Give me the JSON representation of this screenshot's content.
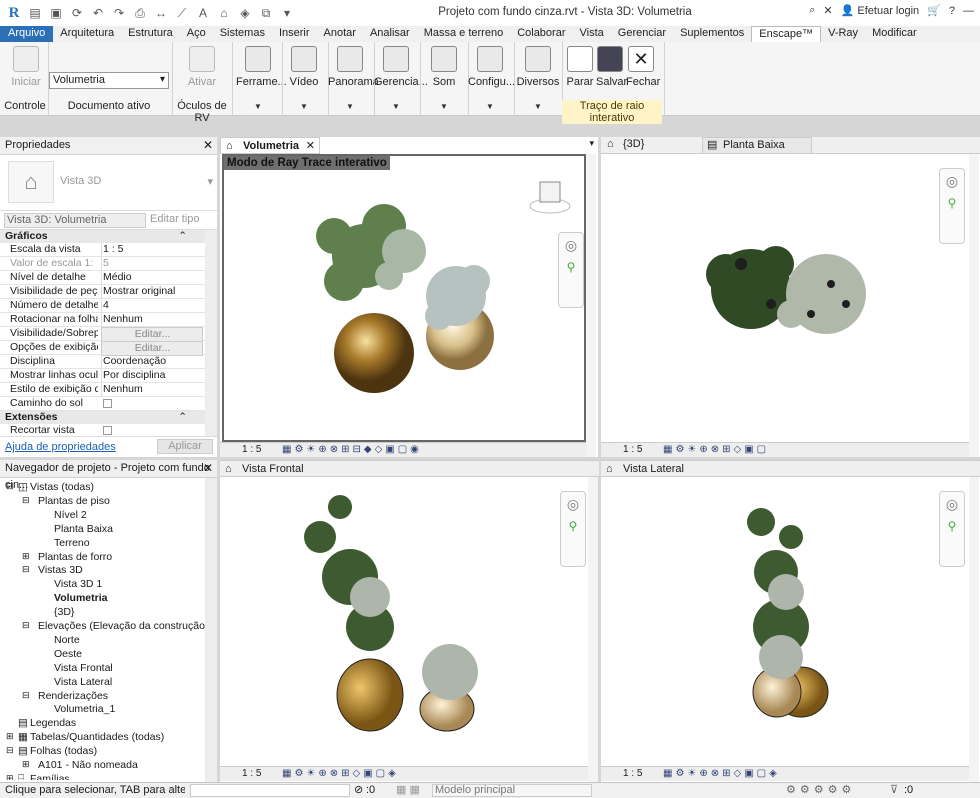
{
  "window_title": "Projeto com fundo cinza.rvt - Vista 3D: Volumetria",
  "user": {
    "login_label": "Efetuar login"
  },
  "tabs": [
    "Arquivo",
    "Arquitetura",
    "Estrutura",
    "Aço",
    "Sistemas",
    "Inserir",
    "Anotar",
    "Analisar",
    "Massa e terreno",
    "Colaborar",
    "Vista",
    "Gerenciar",
    "Suplementos",
    "Enscape™",
    "V-Ray",
    "Modificar"
  ],
  "ribbon": {
    "controle": {
      "start_label": "Iniciar",
      "panel_label": "Controle"
    },
    "documento": {
      "select_value": "Volumetria",
      "panel_label": "Documento ativo"
    },
    "oculos": {
      "activate_label": "Ativar",
      "panel_label": "Óculos de RV"
    },
    "buttons": [
      "Ferrame...",
      "Vídeo",
      "Panorama",
      "Gerencia...",
      "Som",
      "Configu...",
      "Diversos"
    ],
    "raytrace": {
      "buttons": [
        "Parar",
        "Salvar",
        "Fechar"
      ],
      "panel_label": "Traço de raio interativo"
    }
  },
  "properties": {
    "title": "Propriedades",
    "type_name": "Vista 3D",
    "view_selector": "Vista 3D: Volumetria",
    "edit_type": "Editar tipo",
    "groups": [
      {
        "name": "Gráficos",
        "rows": [
          {
            "k": "Escala da vista",
            "v": "1 : 5"
          },
          {
            "k": "Valor de escala   1:",
            "v": "5"
          },
          {
            "k": "Nível de detalhe",
            "v": "Médio"
          },
          {
            "k": "Visibilidade de peças",
            "v": "Mostrar original"
          },
          {
            "k": "Número de detalhe",
            "v": "4"
          },
          {
            "k": "Rotacionar na folha",
            "v": "Nenhum"
          },
          {
            "k": "Visibilidade/Sobrep...",
            "v": "Editar..."
          },
          {
            "k": "Opções de exibição...",
            "v": "Editar..."
          },
          {
            "k": "Disciplina",
            "v": "Coordenação"
          },
          {
            "k": "Mostrar linhas ocult...",
            "v": "Por disciplina"
          },
          {
            "k": "Estilo de exibição d...",
            "v": "Nenhum"
          },
          {
            "k": "Caminho do sol",
            "v": ""
          }
        ]
      },
      {
        "name": "Extensões",
        "rows": [
          {
            "k": "Recortar vista",
            "v": ""
          }
        ]
      }
    ],
    "help_link": "Ajuda de propriedades",
    "apply": "Aplicar"
  },
  "navigator": {
    "title": "Navegador de projeto - Projeto com fundo cin...",
    "items": [
      {
        "label": "Vistas (todas)",
        "depth": 1,
        "bold": false
      },
      {
        "label": "Plantas de piso",
        "depth": 2,
        "bold": false
      },
      {
        "label": "Nível 2",
        "depth": 3,
        "bold": false
      },
      {
        "label": "Planta Baixa",
        "depth": 3,
        "bold": false
      },
      {
        "label": "Terreno",
        "depth": 3,
        "bold": false
      },
      {
        "label": "Plantas de forro",
        "depth": 2,
        "bold": false
      },
      {
        "label": "Vistas 3D",
        "depth": 2,
        "bold": false
      },
      {
        "label": "Vista 3D 1",
        "depth": 3,
        "bold": false
      },
      {
        "label": "Volumetria",
        "depth": 3,
        "bold": true
      },
      {
        "label": "{3D}",
        "depth": 3,
        "bold": false
      },
      {
        "label": "Elevações (Elevação da construção)",
        "depth": 2,
        "bold": false
      },
      {
        "label": "Norte",
        "depth": 3,
        "bold": false
      },
      {
        "label": "Oeste",
        "depth": 3,
        "bold": false
      },
      {
        "label": "Vista Frontal",
        "depth": 3,
        "bold": false
      },
      {
        "label": "Vista Lateral",
        "depth": 3,
        "bold": false
      },
      {
        "label": "Renderizações",
        "depth": 2,
        "bold": false
      },
      {
        "label": "Volumetria_1",
        "depth": 3,
        "bold": false
      },
      {
        "label": "Legendas",
        "depth": 1,
        "bold": false
      },
      {
        "label": "Tabelas/Quantidades (todas)",
        "depth": 1,
        "bold": false
      },
      {
        "label": "Folhas (todas)",
        "depth": 1,
        "bold": false
      },
      {
        "label": "A101 - Não nomeada",
        "depth": 2,
        "bold": false
      },
      {
        "label": "Famílias",
        "depth": 1,
        "bold": false
      }
    ]
  },
  "views": {
    "top_left": {
      "tab": "Volumetria",
      "banner": "Modo de Ray Trace interativo",
      "scale": "1 : 5"
    },
    "top_right_tabs": [
      "{3D}",
      "Planta Baixa"
    ],
    "top_right": {
      "scale": "1 : 5"
    },
    "bottom_left": {
      "tab": "Vista Frontal",
      "scale": "1 : 5"
    },
    "bottom_right": {
      "tab": "Vista Lateral",
      "scale": "1 : 5"
    }
  },
  "status": {
    "hint": "Clique para selecionar, TAB para alternar",
    "counter": ":0",
    "model": "Modelo principal",
    "filter_count": ":0"
  }
}
